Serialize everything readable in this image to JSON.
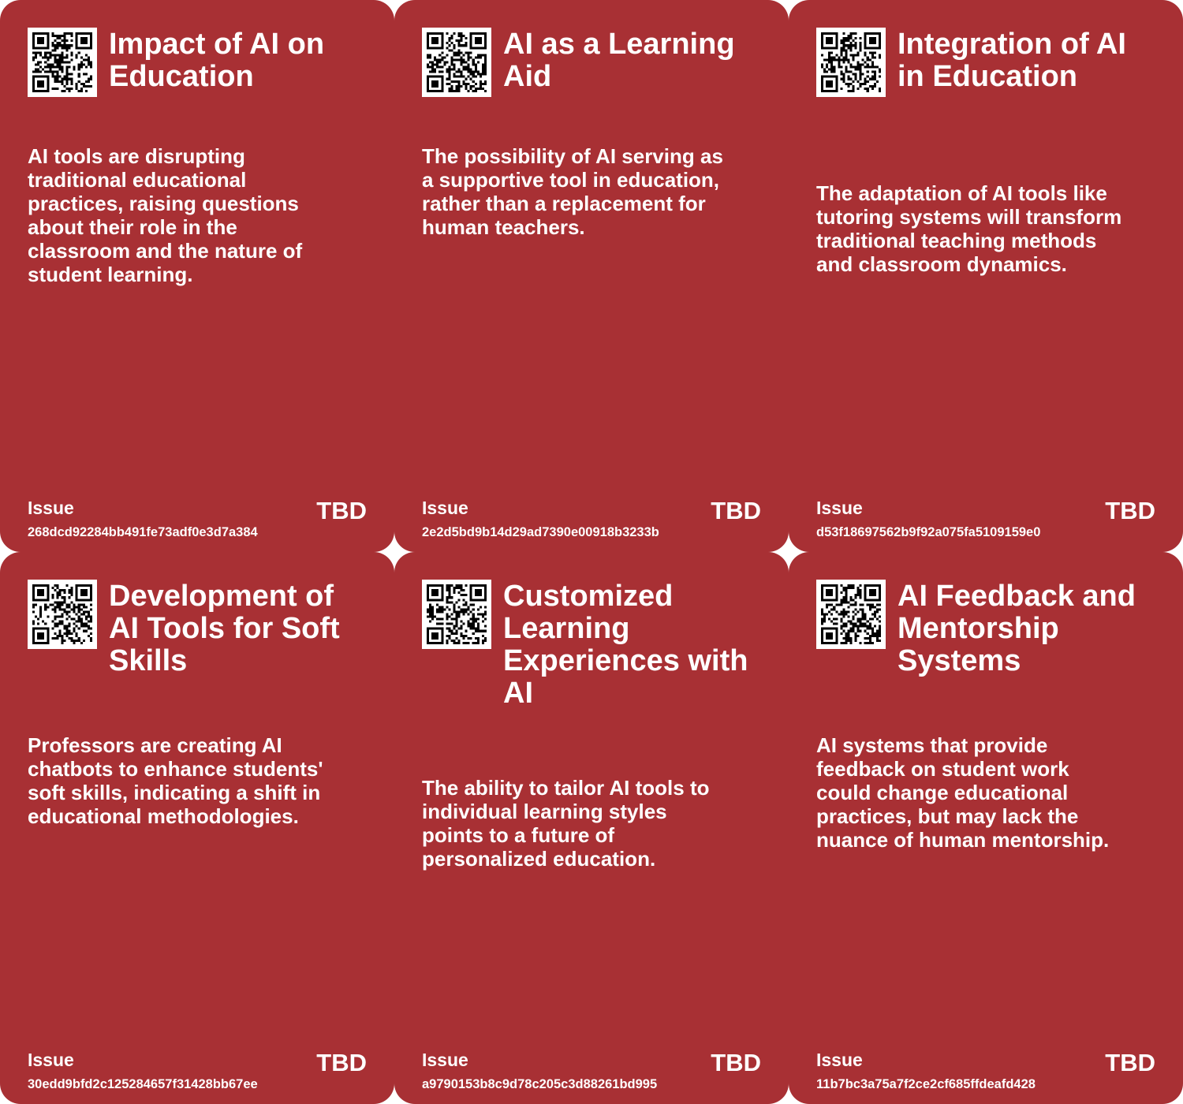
{
  "cards": [
    {
      "title": "Impact of AI on Education",
      "description": "AI tools are disrupting traditional educational practices, raising questions about their role in the classroom and the nature of student learning.",
      "issue_label": "Issue",
      "issue_id": "268dcd92284bb491fe73adf0e3d7a384",
      "status": "TBD",
      "qr_icon": "qr-code-icon"
    },
    {
      "title": "AI as a Learning Aid",
      "description": "The possibility of AI serving as a supportive tool in education, rather than a replacement for human teachers.",
      "issue_label": "Issue",
      "issue_id": "2e2d5bd9b14d29ad7390e00918b3233b",
      "status": "TBD",
      "qr_icon": "qr-code-icon"
    },
    {
      "title": "Integration of AI in Education",
      "description": "The adaptation of AI tools like tutoring systems will transform traditional teaching methods and classroom dynamics.",
      "issue_label": "Issue",
      "issue_id": "d53f18697562b9f92a075fa5109159e0",
      "status": "TBD",
      "qr_icon": "qr-code-icon"
    },
    {
      "title": "Development of AI Tools for Soft Skills",
      "description": "Professors are creating AI chatbots to enhance students' soft skills, indicating a shift in educational methodologies.",
      "issue_label": "Issue",
      "issue_id": "30edd9bfd2c125284657f31428bb67ee",
      "status": "TBD",
      "qr_icon": "qr-code-icon"
    },
    {
      "title": "Customized Learning Experiences with AI",
      "description": "The ability to tailor AI tools to individual learning styles points to a future of personalized education.",
      "issue_label": "Issue",
      "issue_id": "a9790153b8c9d78c205c3d88261bd995",
      "status": "TBD",
      "qr_icon": "qr-code-icon"
    },
    {
      "title": "AI Feedback and Mentorship Systems",
      "description": "AI systems that provide feedback on student work could change educational practices, but may lack the nuance of human mentorship.",
      "issue_label": "Issue",
      "issue_id": "11b7bc3a75a7f2ce2cf685ffdeafd428",
      "status": "TBD",
      "qr_icon": "qr-code-icon"
    }
  ],
  "colors": {
    "card_background": "#a83034",
    "text": "#ffffff",
    "qr_dark": "#000000",
    "qr_light": "#ffffff"
  }
}
